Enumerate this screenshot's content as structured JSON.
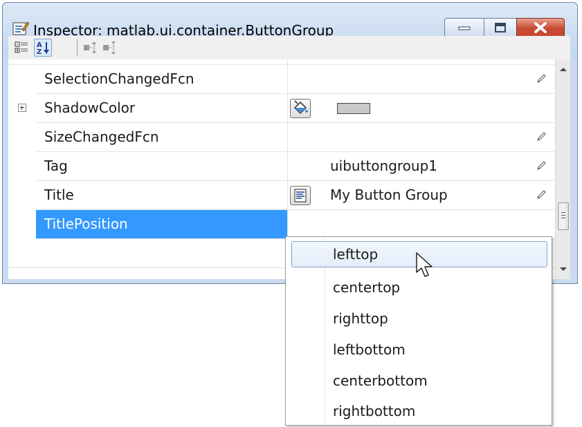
{
  "window": {
    "title": "Inspector:  matlab.ui.container.ButtonGroup"
  },
  "toolbar": {
    "buttons": [
      {
        "name": "categorized-view-icon",
        "active": false
      },
      {
        "name": "alphabetical-sort-icon",
        "active": true
      },
      {
        "name": "expand-all-icon",
        "active": false
      },
      {
        "name": "collapse-all-icon",
        "active": false
      }
    ]
  },
  "properties": [
    {
      "name": "SelectionChangedFcn",
      "value": "",
      "editable": true
    },
    {
      "name": "ShadowColor",
      "value": "",
      "expandable": true,
      "color_swatch": "#c8c8c8"
    },
    {
      "name": "SizeChangedFcn",
      "value": "",
      "editable": true
    },
    {
      "name": "Tag",
      "value": "uibuttongroup1",
      "editable": true
    },
    {
      "name": "Title",
      "value": "My Button Group",
      "editable": true
    },
    {
      "name": "TitlePosition",
      "value": "",
      "selected": true
    }
  ],
  "dropdown": {
    "options": [
      "lefttop",
      "centertop",
      "righttop",
      "leftbottom",
      "centerbottom",
      "rightbottom"
    ],
    "highlighted": "lefttop"
  },
  "colors": {
    "selection": "#3399ff",
    "title_bar": "#c9daf0",
    "close_button": "#c74a32"
  }
}
